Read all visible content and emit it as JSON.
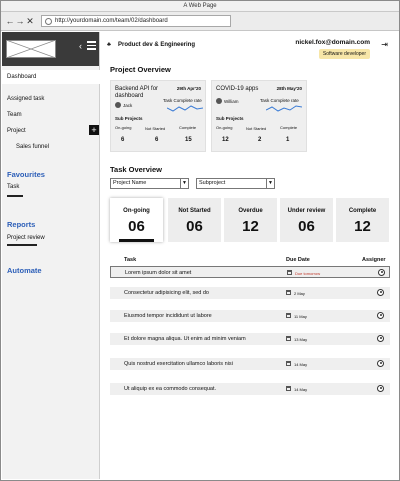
{
  "browser": {
    "title": "A Web Page",
    "url": "http://yourdomain.com/team/02/dashboard",
    "back": "←",
    "forward": "→",
    "close": "✕"
  },
  "sidebar": {
    "items": [
      {
        "label": "Dashboard"
      },
      {
        "label": "Assigned task"
      },
      {
        "label": "Team"
      },
      {
        "label": "Project"
      },
      {
        "label": "Sales funnel"
      }
    ],
    "add_label": "+",
    "favourites": {
      "title": "Favourites",
      "items": [
        {
          "label": "Task"
        }
      ]
    },
    "reports": {
      "title": "Reports",
      "items": [
        {
          "label": "Project review"
        }
      ]
    },
    "automate": {
      "title": "Automate"
    }
  },
  "header": {
    "breadcrumb": "Product dev & Engineering",
    "user_email": "nickel.fox@domain.com",
    "role": "Software developer"
  },
  "project_overview": {
    "title": "Project Overview",
    "cards": [
      {
        "name": "Backend API for dashboard",
        "date": "29th Apr'20",
        "person": "Jack",
        "rate_label": "Task Complete rate",
        "sub_label": "Sub Projects",
        "stats": [
          {
            "label": "On-going",
            "value": "6"
          },
          {
            "label": "Not Started",
            "value": "6"
          },
          {
            "label": "Complete",
            "value": "15"
          }
        ]
      },
      {
        "name": "COVID-19 apps",
        "date": "28th May'20",
        "person": "William",
        "rate_label": "Task Complete rate",
        "sub_label": "Sub Projects",
        "stats": [
          {
            "label": "On-going",
            "value": "12"
          },
          {
            "label": "Not Started",
            "value": "2"
          },
          {
            "label": "Complete",
            "value": "1"
          }
        ]
      }
    ]
  },
  "task_overview": {
    "title": "Task Overview",
    "filters": [
      {
        "value": "Project Name",
        "caret": "▼"
      },
      {
        "value": "Subproject",
        "caret": "▼"
      }
    ],
    "stats": [
      {
        "label": "On-going",
        "value": "06",
        "active": true
      },
      {
        "label": "Not Started",
        "value": "06"
      },
      {
        "label": "Overdue",
        "value": "12"
      },
      {
        "label": "Under review",
        "value": "06"
      },
      {
        "label": "Complete",
        "value": "12"
      }
    ]
  },
  "task_table": {
    "columns": {
      "task": "Task",
      "due": "Due Date",
      "assignee": "Assigner"
    },
    "rows": [
      {
        "task": "Lorem ipsum dolor sit amet",
        "due": "Due tomorrow",
        "overdue": true
      },
      {
        "task": "Consectetur adipisicing elit, sed do",
        "due": "2 May"
      },
      {
        "task": "Eiusmod tempor incididunt ut labore",
        "due": "11 May"
      },
      {
        "task": "Et dolore magna aliqua. Ut enim ad minim veniam",
        "due": "13 May"
      },
      {
        "task": "Quis nostrud exercitation ullamco laboris nisi",
        "due": "14 May"
      },
      {
        "task": "Ut aliquip ex ea commodo consequat.",
        "due": "14 May"
      }
    ]
  },
  "colors": {
    "accent": "#2d5fb8",
    "badge": "#f7e6a8",
    "overdue": "#c0392b"
  }
}
